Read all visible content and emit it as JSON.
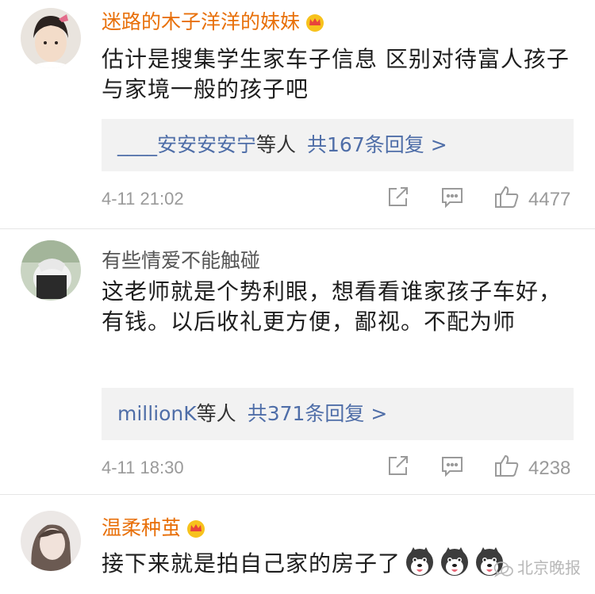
{
  "comments": [
    {
      "username": "迷路的木子洋洋的妹妹",
      "username_color": "#e8700a",
      "text": "估计是搜集学生家车子信息  区别对待富人孩子与家境一般的孩子吧",
      "reply_users": "____安安安安宁",
      "reply_etc": "等人",
      "reply_count": "共167条回复 >",
      "time": "4-11 21:02",
      "likes": "4477"
    },
    {
      "username": "有些情爱不能触碰",
      "username_color": "#555555",
      "text": "这老师就是个势利眼，想看看谁家孩子车好，有钱。以后收礼更方便，鄙视。不配为师",
      "reply_users": "millionK",
      "reply_etc": "等人",
      "reply_count": "共371条回复 >",
      "time": "4-11 18:30",
      "likes": "4238"
    },
    {
      "username": "温柔种茧",
      "username_color": "#e8700a",
      "text": "接下来就是拍自己家的房子了"
    }
  ],
  "watermark": "北京晚报",
  "icons": {
    "vip": "crown-icon",
    "share": "share-icon",
    "comment": "comment-icon",
    "like": "thumbs-up-icon",
    "emoji": "husky-emoji-icon"
  },
  "colors": {
    "vip_name": "#e8700a",
    "link": "#4f6ea8",
    "meta": "#9a9a9a",
    "reply_bg": "#f2f2f2"
  }
}
